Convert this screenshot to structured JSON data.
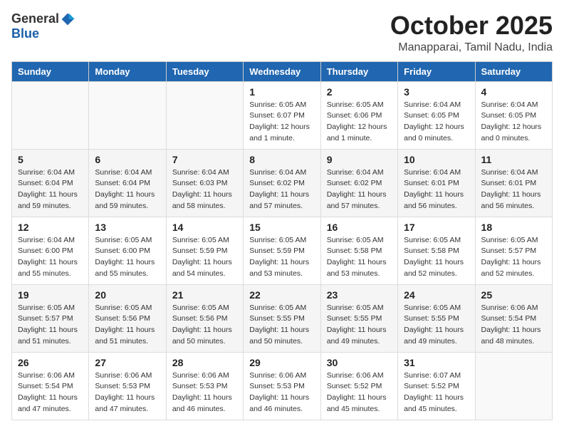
{
  "header": {
    "logo_general": "General",
    "logo_blue": "Blue",
    "month": "October 2025",
    "location": "Manapparai, Tamil Nadu, India"
  },
  "weekdays": [
    "Sunday",
    "Monday",
    "Tuesday",
    "Wednesday",
    "Thursday",
    "Friday",
    "Saturday"
  ],
  "weeks": [
    [
      {
        "day": "",
        "info": ""
      },
      {
        "day": "",
        "info": ""
      },
      {
        "day": "",
        "info": ""
      },
      {
        "day": "1",
        "info": "Sunrise: 6:05 AM\nSunset: 6:07 PM\nDaylight: 12 hours\nand 1 minute."
      },
      {
        "day": "2",
        "info": "Sunrise: 6:05 AM\nSunset: 6:06 PM\nDaylight: 12 hours\nand 1 minute."
      },
      {
        "day": "3",
        "info": "Sunrise: 6:04 AM\nSunset: 6:05 PM\nDaylight: 12 hours\nand 0 minutes."
      },
      {
        "day": "4",
        "info": "Sunrise: 6:04 AM\nSunset: 6:05 PM\nDaylight: 12 hours\nand 0 minutes."
      }
    ],
    [
      {
        "day": "5",
        "info": "Sunrise: 6:04 AM\nSunset: 6:04 PM\nDaylight: 11 hours\nand 59 minutes."
      },
      {
        "day": "6",
        "info": "Sunrise: 6:04 AM\nSunset: 6:04 PM\nDaylight: 11 hours\nand 59 minutes."
      },
      {
        "day": "7",
        "info": "Sunrise: 6:04 AM\nSunset: 6:03 PM\nDaylight: 11 hours\nand 58 minutes."
      },
      {
        "day": "8",
        "info": "Sunrise: 6:04 AM\nSunset: 6:02 PM\nDaylight: 11 hours\nand 57 minutes."
      },
      {
        "day": "9",
        "info": "Sunrise: 6:04 AM\nSunset: 6:02 PM\nDaylight: 11 hours\nand 57 minutes."
      },
      {
        "day": "10",
        "info": "Sunrise: 6:04 AM\nSunset: 6:01 PM\nDaylight: 11 hours\nand 56 minutes."
      },
      {
        "day": "11",
        "info": "Sunrise: 6:04 AM\nSunset: 6:01 PM\nDaylight: 11 hours\nand 56 minutes."
      }
    ],
    [
      {
        "day": "12",
        "info": "Sunrise: 6:04 AM\nSunset: 6:00 PM\nDaylight: 11 hours\nand 55 minutes."
      },
      {
        "day": "13",
        "info": "Sunrise: 6:05 AM\nSunset: 6:00 PM\nDaylight: 11 hours\nand 55 minutes."
      },
      {
        "day": "14",
        "info": "Sunrise: 6:05 AM\nSunset: 5:59 PM\nDaylight: 11 hours\nand 54 minutes."
      },
      {
        "day": "15",
        "info": "Sunrise: 6:05 AM\nSunset: 5:59 PM\nDaylight: 11 hours\nand 53 minutes."
      },
      {
        "day": "16",
        "info": "Sunrise: 6:05 AM\nSunset: 5:58 PM\nDaylight: 11 hours\nand 53 minutes."
      },
      {
        "day": "17",
        "info": "Sunrise: 6:05 AM\nSunset: 5:58 PM\nDaylight: 11 hours\nand 52 minutes."
      },
      {
        "day": "18",
        "info": "Sunrise: 6:05 AM\nSunset: 5:57 PM\nDaylight: 11 hours\nand 52 minutes."
      }
    ],
    [
      {
        "day": "19",
        "info": "Sunrise: 6:05 AM\nSunset: 5:57 PM\nDaylight: 11 hours\nand 51 minutes."
      },
      {
        "day": "20",
        "info": "Sunrise: 6:05 AM\nSunset: 5:56 PM\nDaylight: 11 hours\nand 51 minutes."
      },
      {
        "day": "21",
        "info": "Sunrise: 6:05 AM\nSunset: 5:56 PM\nDaylight: 11 hours\nand 50 minutes."
      },
      {
        "day": "22",
        "info": "Sunrise: 6:05 AM\nSunset: 5:55 PM\nDaylight: 11 hours\nand 50 minutes."
      },
      {
        "day": "23",
        "info": "Sunrise: 6:05 AM\nSunset: 5:55 PM\nDaylight: 11 hours\nand 49 minutes."
      },
      {
        "day": "24",
        "info": "Sunrise: 6:05 AM\nSunset: 5:55 PM\nDaylight: 11 hours\nand 49 minutes."
      },
      {
        "day": "25",
        "info": "Sunrise: 6:06 AM\nSunset: 5:54 PM\nDaylight: 11 hours\nand 48 minutes."
      }
    ],
    [
      {
        "day": "26",
        "info": "Sunrise: 6:06 AM\nSunset: 5:54 PM\nDaylight: 11 hours\nand 47 minutes."
      },
      {
        "day": "27",
        "info": "Sunrise: 6:06 AM\nSunset: 5:53 PM\nDaylight: 11 hours\nand 47 minutes."
      },
      {
        "day": "28",
        "info": "Sunrise: 6:06 AM\nSunset: 5:53 PM\nDaylight: 11 hours\nand 46 minutes."
      },
      {
        "day": "29",
        "info": "Sunrise: 6:06 AM\nSunset: 5:53 PM\nDaylight: 11 hours\nand 46 minutes."
      },
      {
        "day": "30",
        "info": "Sunrise: 6:06 AM\nSunset: 5:52 PM\nDaylight: 11 hours\nand 45 minutes."
      },
      {
        "day": "31",
        "info": "Sunrise: 6:07 AM\nSunset: 5:52 PM\nDaylight: 11 hours\nand 45 minutes."
      },
      {
        "day": "",
        "info": ""
      }
    ]
  ]
}
